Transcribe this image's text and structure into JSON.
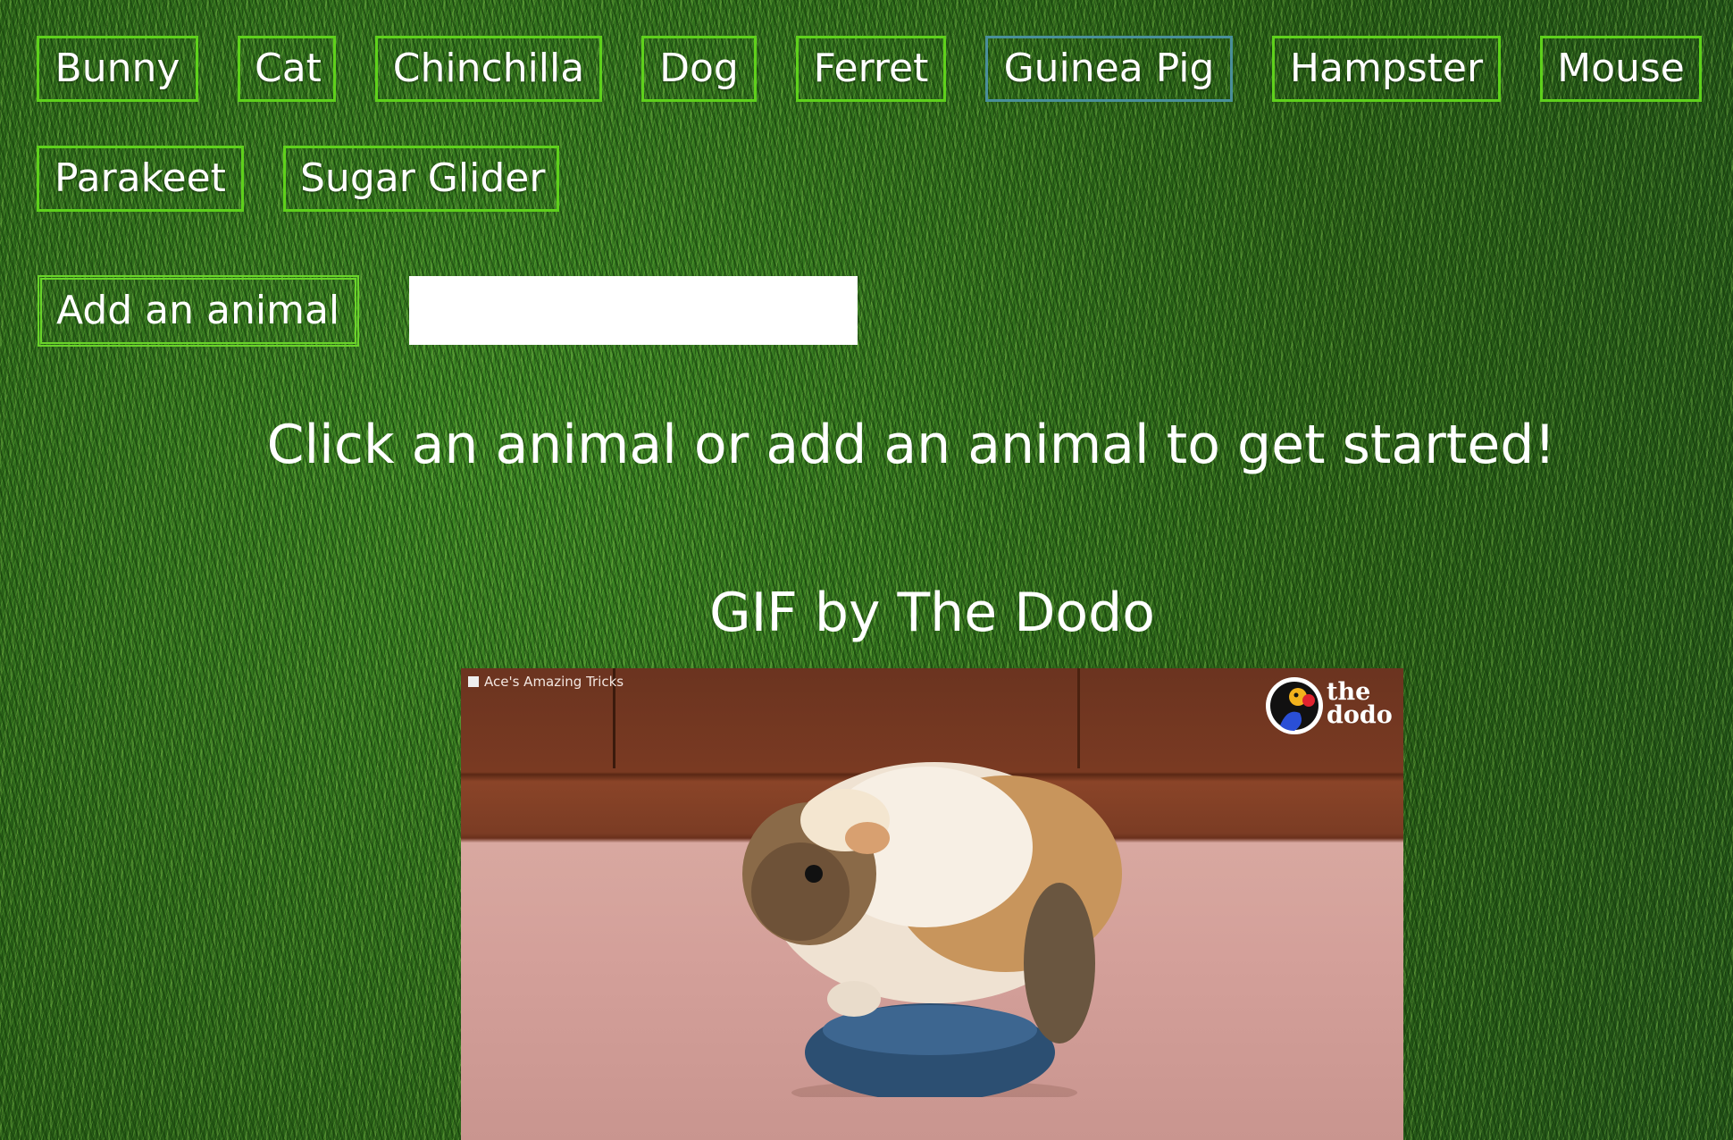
{
  "animals": [
    {
      "label": "Bunny"
    },
    {
      "label": "Cat"
    },
    {
      "label": "Chinchilla"
    },
    {
      "label": "Dog"
    },
    {
      "label": "Ferret"
    },
    {
      "label": "Guinea Pig"
    },
    {
      "label": "Hampster"
    },
    {
      "label": "Mouse"
    },
    {
      "label": "Parakeet"
    },
    {
      "label": "Sugar Glider"
    }
  ],
  "add_form": {
    "button_label": "Add an animal",
    "input_value": ""
  },
  "prompt": "Click an animal or add an animal to get started!",
  "gif": {
    "caption": "GIF by The Dodo",
    "source_label": "Ace's Amazing Tricks",
    "logo_text_line1": "the",
    "logo_text_line2": "dodo"
  },
  "colors": {
    "button_border": "#5fd11c",
    "active_button_border": "#4a8f9a",
    "background": "#2e6b1c"
  }
}
